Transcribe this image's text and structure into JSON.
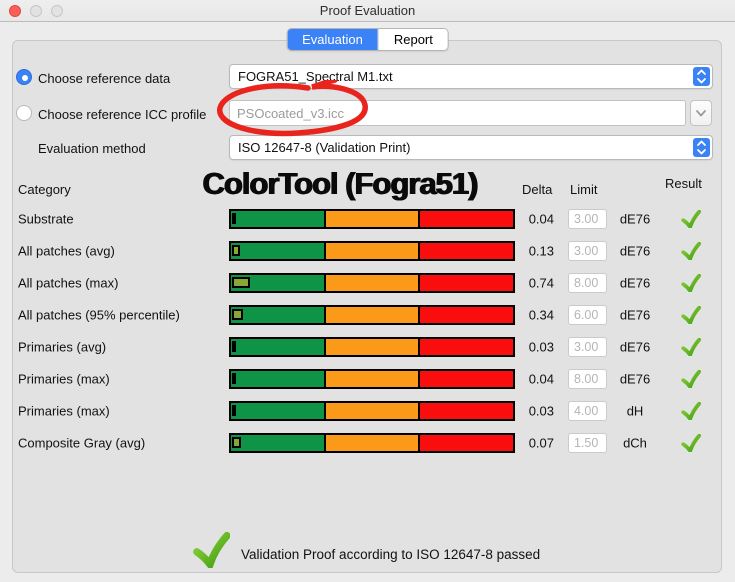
{
  "window": {
    "title": "Proof Evaluation"
  },
  "tabs": {
    "evaluation": "Evaluation",
    "report": "Report"
  },
  "form": {
    "reference_data_label": "Choose reference data",
    "reference_data_value": "FOGRA51_Spectral M1.txt",
    "icc_profile_label": "Choose reference ICC profile",
    "icc_profile_value": "PSOcoated_v3.icc",
    "evaluation_method_label": "Evaluation method",
    "evaluation_method_value": "ISO 12647-8 (Validation Print)"
  },
  "table": {
    "title": "ColorTool (Fogra51)",
    "headers": {
      "category": "Category",
      "delta": "Delta",
      "limit": "Limit",
      "result": "Result"
    },
    "rows": [
      {
        "category": "Substrate",
        "delta": "0.04",
        "limit": "3.00",
        "unit": "dE76",
        "passed": true
      },
      {
        "category": "All patches (avg)",
        "delta": "0.13",
        "limit": "3.00",
        "unit": "dE76",
        "passed": true
      },
      {
        "category": "All patches (max)",
        "delta": "0.74",
        "limit": "8.00",
        "unit": "dE76",
        "passed": true
      },
      {
        "category": "All patches (95% percentile)",
        "delta": "0.34",
        "limit": "6.00",
        "unit": "dE76",
        "passed": true
      },
      {
        "category": "Primaries (avg)",
        "delta": "0.03",
        "limit": "3.00",
        "unit": "dE76",
        "passed": true
      },
      {
        "category": "Primaries (max)",
        "delta": "0.04",
        "limit": "8.00",
        "unit": "dE76",
        "passed": true
      },
      {
        "category": "Primaries (max)",
        "delta": "0.03",
        "limit": "4.00",
        "unit": "dH",
        "passed": true
      },
      {
        "category": "Composite Gray (avg)",
        "delta": "0.07",
        "limit": "1.50",
        "unit": "dCh",
        "passed": true
      }
    ]
  },
  "footer": {
    "message": "Validation Proof according to ISO 12647-8 passed"
  },
  "colors": {
    "accent": "#3b82f7",
    "bar-green": "#0e9347",
    "bar-orange": "#fb9a18",
    "bar-red": "#f90d0d",
    "indicator": "#86a835",
    "check-green": "#52b81f",
    "annotation-red": "#e8241d"
  }
}
